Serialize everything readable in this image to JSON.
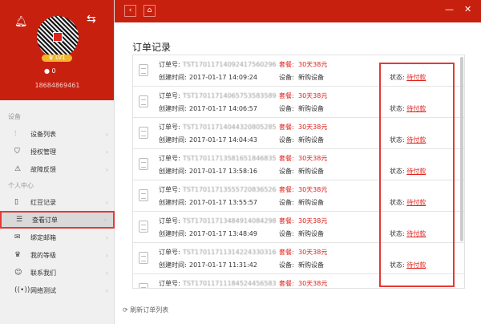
{
  "profile": {
    "level": "LV1",
    "beans": "0",
    "phone": "18684869461"
  },
  "sidebar": {
    "section_device": "设备",
    "device_items": [
      {
        "icon": "sliders-icon",
        "glyph": "⫶",
        "label": "设备列表"
      },
      {
        "icon": "shield-icon",
        "glyph": "⛉",
        "label": "授权管理"
      },
      {
        "icon": "warning-icon",
        "glyph": "⚠",
        "label": "故障反馈"
      }
    ],
    "section_personal": "个人中心",
    "personal_items": [
      {
        "icon": "bean-record-icon",
        "glyph": "▯",
        "label": "红豆记录"
      },
      {
        "icon": "order-icon",
        "glyph": "☰",
        "label": "查看订单"
      },
      {
        "icon": "mail-icon",
        "glyph": "✉",
        "label": "绑定邮箱"
      },
      {
        "icon": "crown-icon",
        "glyph": "♛",
        "label": "我的等级"
      },
      {
        "icon": "smile-icon",
        "glyph": "☺",
        "label": "联系我们"
      },
      {
        "icon": "network-icon",
        "glyph": "((•))",
        "label": "网络测试"
      }
    ]
  },
  "main": {
    "title": "订单记录",
    "refresh_label": "刷新订单列表",
    "labels": {
      "order_no": "订单号:",
      "created": "创建时间:",
      "package": "套餐:",
      "device": "设备:",
      "status": "状态:"
    },
    "orders": [
      {
        "no": "TST17011714092417560296",
        "time": "2017-01-17 14:09:24",
        "package": "30天38元",
        "device": "新购设备",
        "status": "待付款"
      },
      {
        "no": "TST17011714065753583589",
        "time": "2017-01-17 14:06:57",
        "package": "30天38元",
        "device": "新购设备",
        "status": "待付款"
      },
      {
        "no": "TST17011714044320805285",
        "time": "2017-01-17 14:04:43",
        "package": "30天38元",
        "device": "新购设备",
        "status": "待付款"
      },
      {
        "no": "TST17011713581651846835",
        "time": "2017-01-17 13:58:16",
        "package": "30天38元",
        "device": "新购设备",
        "status": "待付款"
      },
      {
        "no": "TST17011713555720836526",
        "time": "2017-01-17 13:55:57",
        "package": "30天38元",
        "device": "新购设备",
        "status": "待付款"
      },
      {
        "no": "TST17011713484914084298",
        "time": "2017-01-17 13:48:49",
        "package": "30天38元",
        "device": "新购设备",
        "status": "待付款"
      },
      {
        "no": "TST17011711314224330316",
        "time": "2017-01-17 11:31:42",
        "package": "30天38元",
        "device": "新购设备",
        "status": "待付款"
      },
      {
        "no": "TST17011711184524456583",
        "time": "",
        "package": "30天38元",
        "device": "",
        "status": ""
      }
    ]
  }
}
